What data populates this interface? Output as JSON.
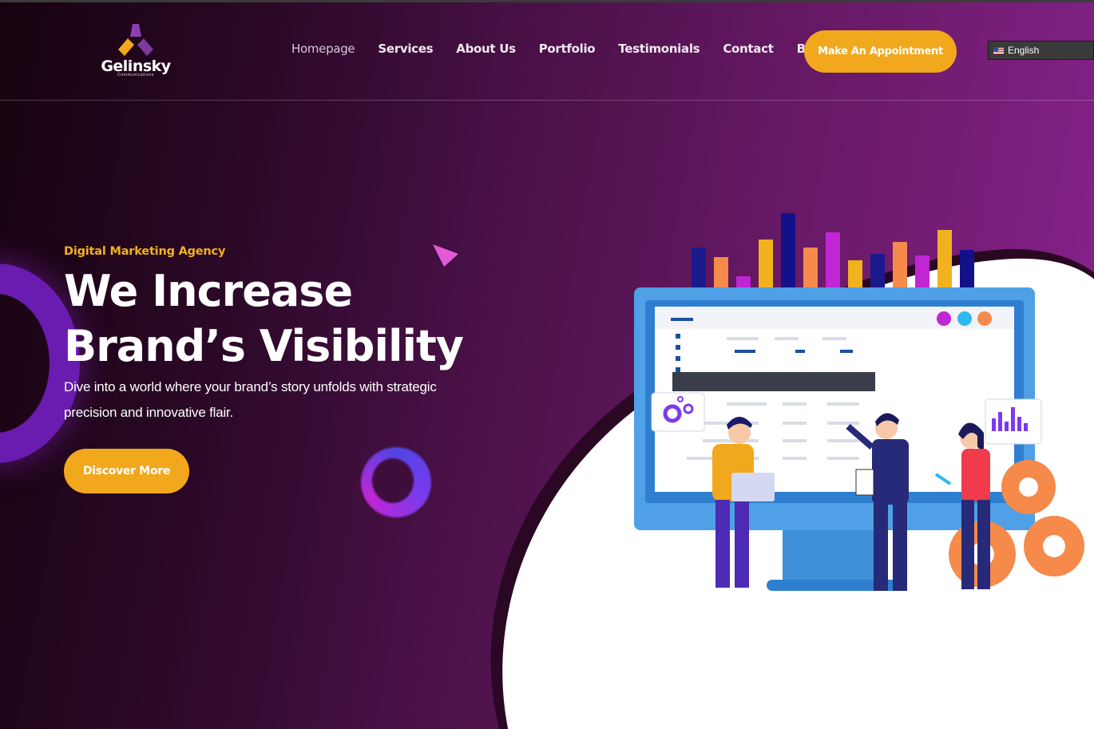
{
  "brand": {
    "name": "Gelinsky",
    "subtitle": "Communications"
  },
  "nav": {
    "items": [
      "Homepage",
      "Services",
      "About Us",
      "Portfolio",
      "Testimonials",
      "Contact",
      "Blog"
    ],
    "cta": "Make An Appointment"
  },
  "language": {
    "label": "English",
    "flag": "us-flag-icon"
  },
  "hero": {
    "eyebrow": "Digital Marketing Agency",
    "headline_line1": "We Increase",
    "headline_line2": "Brand’s Visibility",
    "subtext": "Dive into a world where your brand’s story unfolds with strategic precision and innovative flair.",
    "button": "Discover More"
  },
  "colors": {
    "accent": "#f2a81d",
    "eyebrow": "#f2b21f",
    "bg_dark": "#17030f",
    "bg_purple": "#8a2390"
  }
}
